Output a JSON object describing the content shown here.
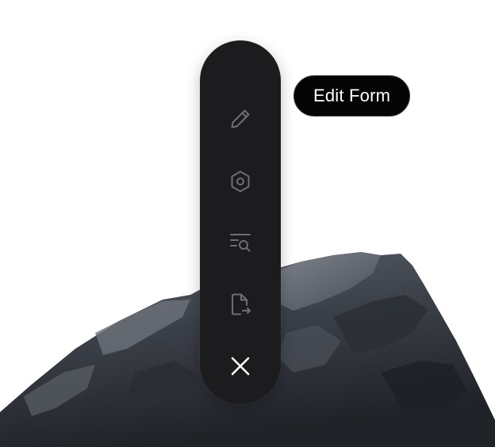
{
  "toolbar": {
    "items": [
      {
        "name": "edit",
        "icon": "pencil-icon"
      },
      {
        "name": "settings",
        "icon": "hexagon-settings-icon"
      },
      {
        "name": "search-list",
        "icon": "list-search-icon"
      },
      {
        "name": "export",
        "icon": "file-export-icon"
      },
      {
        "name": "close",
        "icon": "close-icon"
      }
    ]
  },
  "tooltip": {
    "label": "Edit Form"
  },
  "colors": {
    "toolbar_bg": "#1c1c1e",
    "icon_muted": "#6e6e73",
    "icon_active": "#ffffff",
    "tooltip_bg": "#050505"
  }
}
